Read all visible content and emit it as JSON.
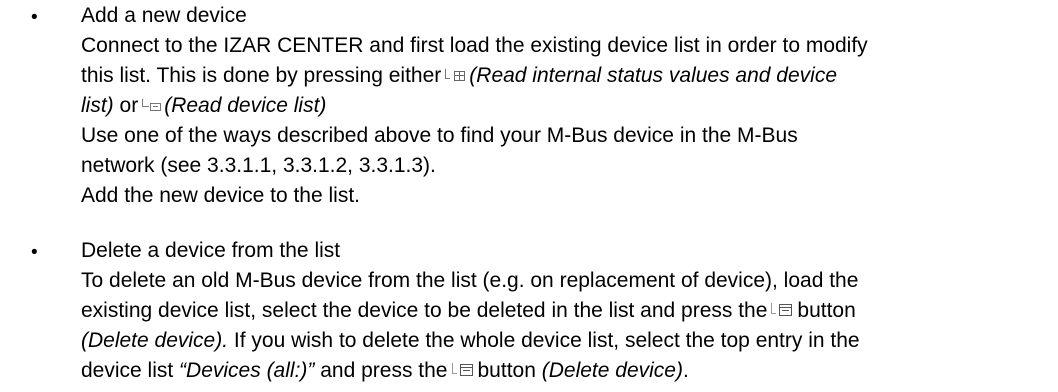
{
  "bullet_glyph": "•",
  "icons": [
    "read-internal-status-icon",
    "read-device-list-icon",
    "delete-device-icon"
  ],
  "add_device": {
    "heading": "Add a new device",
    "line1": "Connect to the IZAR CENTER and first load the existing device list in order to modify",
    "line2_pre": "this list. This is done by pressing either",
    "line2_italic": "(Read internal status values and device",
    "line3_italic_1": "list)",
    "line3_or": "or",
    "line3_italic_2": "(Read device list)",
    "line4": "Use one of the ways described above to find your M-Bus device in the M-Bus",
    "line5": "network (see 3.3.1.1, 3.3.1.2, 3.3.1.3).",
    "line6": "Add the new device to the list."
  },
  "delete_device": {
    "heading": "Delete a device from the list",
    "line1": "To delete an old M-Bus device from the list (e.g. on replacement of device), load the",
    "line2_pre": "existing device list, select the device to be deleted in the list and press the",
    "line2_post": "button",
    "line3_italic": "(Delete device).",
    "line3_rest": "If you wish to delete the whole device list, select the top entry in the",
    "line4_pre": "device list",
    "line4_italic_quote": "“Devices (all:)”",
    "line4_mid": "and press the",
    "line4_button": "button",
    "line4_italic_end": "(Delete device)",
    "line4_end": "."
  }
}
